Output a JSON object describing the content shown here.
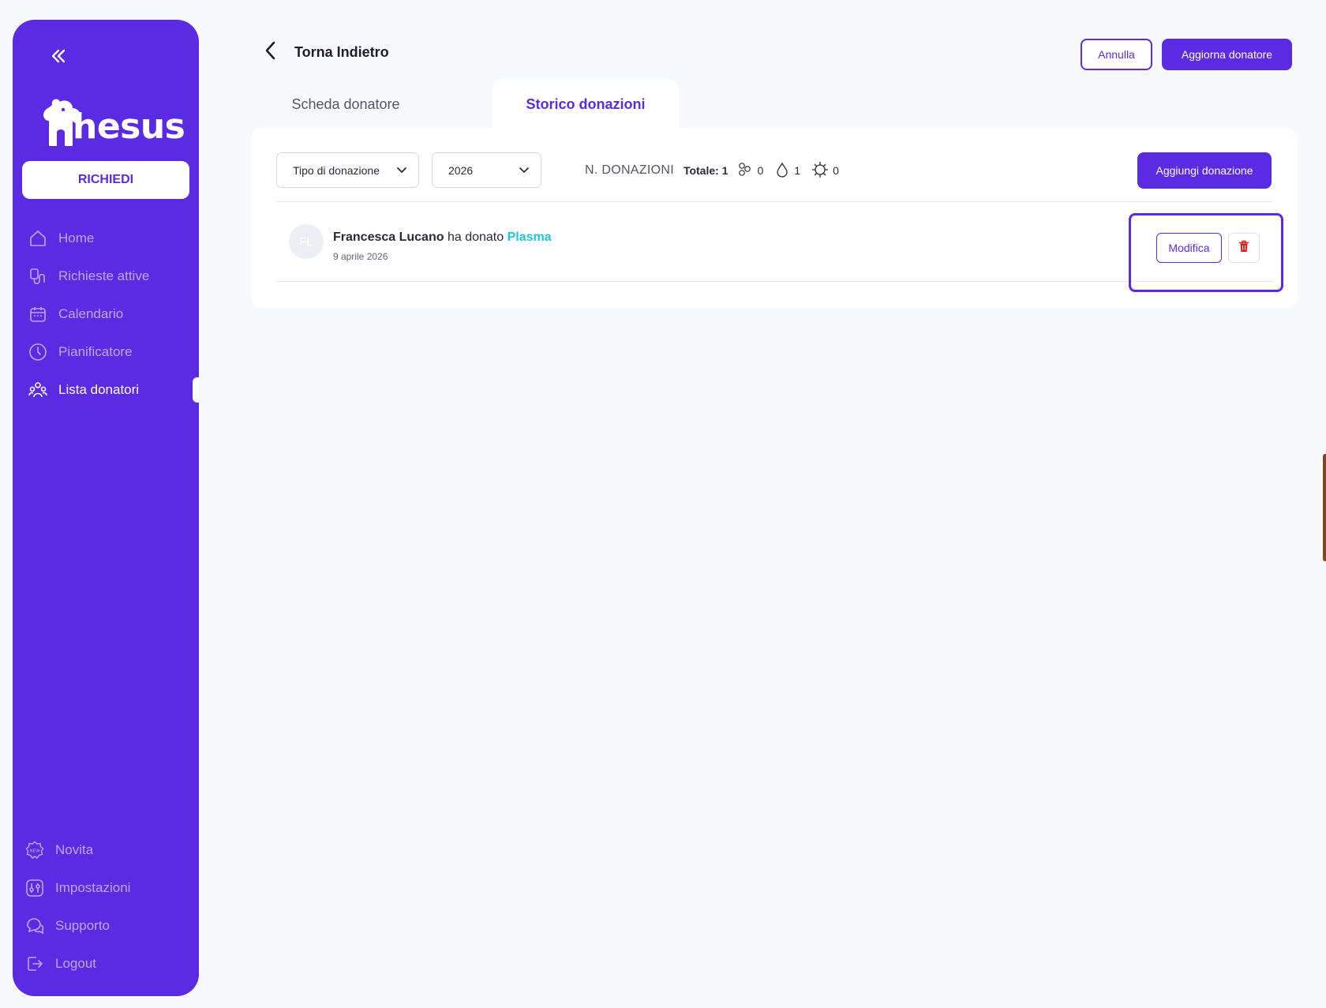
{
  "sidebar": {
    "brand": "hesus",
    "request_button": "RICHIEDI",
    "items": [
      {
        "label": "Home",
        "icon": "home-icon"
      },
      {
        "label": "Richieste attive",
        "icon": "blood-bag-icon"
      },
      {
        "label": "Calendario",
        "icon": "calendar-icon"
      },
      {
        "label": "Pianificatore",
        "icon": "clock-icon"
      },
      {
        "label": "Lista donatori",
        "icon": "users-icon",
        "active": true
      }
    ],
    "bottom_items": [
      {
        "label": "Novita",
        "icon": "new-badge-icon"
      },
      {
        "label": "Impostazioni",
        "icon": "settings-icon"
      },
      {
        "label": "Supporto",
        "icon": "chat-icon"
      },
      {
        "label": "Logout",
        "icon": "logout-icon"
      }
    ]
  },
  "header": {
    "back_label": "Torna Indietro",
    "cancel_label": "Annulla",
    "update_label": "Aggiorna donatore"
  },
  "tabs": [
    {
      "label": "Scheda donatore",
      "active": false
    },
    {
      "label": "Storico donazioni",
      "active": true
    }
  ],
  "filters": {
    "type_select": "Tipo di donazione",
    "year_select": "2026"
  },
  "counts": {
    "label": "N. DONAZIONI",
    "total": "Totale: 1",
    "items": [
      {
        "icon": "blood-cells-icon",
        "value": "0"
      },
      {
        "icon": "drop-icon",
        "value": "1"
      },
      {
        "icon": "platelet-icon",
        "value": "0"
      }
    ]
  },
  "add_button": "Aggiungi donazione",
  "donations": [
    {
      "initials": "FL",
      "name": "Francesca Lucano",
      "verb": "ha donato",
      "type": "Plasma",
      "date": "9 aprile 2026",
      "edit_label": "Modifica"
    }
  ],
  "colors": {
    "primary": "#5a2be2",
    "plasma": "#22c4de",
    "danger": "#e02424"
  }
}
